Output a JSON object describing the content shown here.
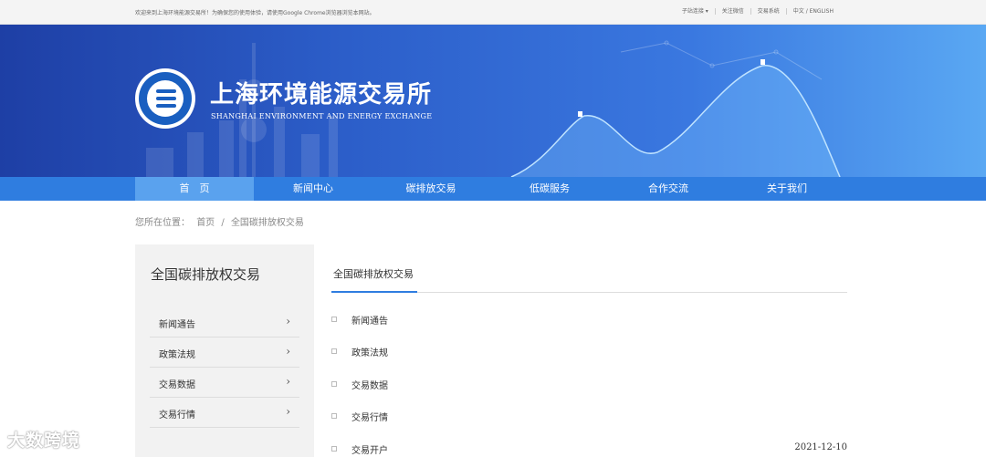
{
  "topbar": {
    "welcome": "欢迎来到上海环境能源交易所！为确保您的使用体验，请使用Google Chrome浏览器浏览本网站。",
    "links": [
      "子站连接 ▾",
      "关注微信",
      "交易系统",
      "中文 / ENGLISH"
    ]
  },
  "brand": {
    "name": "上海环境能源交易所",
    "name_en": "SHANGHAI ENVIRONMENT AND ENERGY EXCHANGE"
  },
  "nav": {
    "items": [
      "首　页",
      "新闻中心",
      "碳排放交易",
      "低碳服务",
      "合作交流",
      "关于我们"
    ]
  },
  "breadcrumb": {
    "prefix": "您所在位置：",
    "home": "首页",
    "sep": "/",
    "current": "全国碳排放权交易"
  },
  "sidebar": {
    "title": "全国碳排放权交易",
    "items": [
      "新闻通告",
      "政策法规",
      "交易数据",
      "交易行情"
    ]
  },
  "content": {
    "tab": "全国碳排放权交易",
    "items": [
      {
        "title": "新闻通告",
        "date": ""
      },
      {
        "title": "政策法规",
        "date": ""
      },
      {
        "title": "交易数据",
        "date": ""
      },
      {
        "title": "交易行情",
        "date": ""
      },
      {
        "title": "交易开户",
        "date": "2021-12-10"
      }
    ]
  },
  "watermark": {
    "text": "大数跨境"
  },
  "colors": {
    "nav": "#2f7de0",
    "nav_active": "#5aa2ee",
    "banner_start": "#1e3fa5",
    "banner_end": "#5aa8f3"
  }
}
